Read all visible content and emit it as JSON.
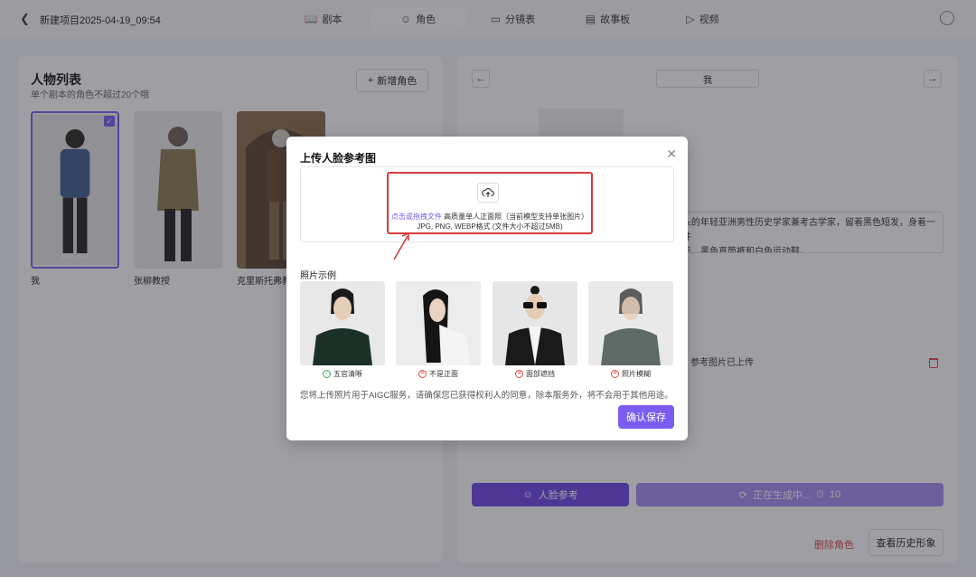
{
  "header": {
    "back_icon": "chevron-left-icon",
    "project_title": "新建项目2025-04-19_09:54",
    "tabs": [
      {
        "label": "剧本",
        "icon": "book-icon"
      },
      {
        "label": "角色",
        "icon": "smile-icon"
      },
      {
        "label": "分镜表",
        "icon": "clapper-icon"
      },
      {
        "label": "故事板",
        "icon": "film-icon"
      },
      {
        "label": "视频",
        "icon": "video-icon"
      }
    ],
    "active_tab": "角色",
    "user_icon": "user-icon"
  },
  "left_panel": {
    "title": "人物列表",
    "subtitle": "单个剧本的角色不超过20个哦",
    "add_button": "新增角色",
    "characters": [
      {
        "name": "我",
        "selected": true
      },
      {
        "name": "张柳教授",
        "selected": false
      },
      {
        "name": "克里斯托弗教",
        "selected": false
      }
    ]
  },
  "right_panel": {
    "character_name": "我",
    "description": "头的年轻亚洲男性历史学家兼考古学家，留着黑色短发，身着一件\n衫、黑色直筒裤和白色运动鞋。",
    "uploaded_text": "参考图片已上传",
    "face_ref_button": "人脸参考",
    "generating_button": "正在生成中...",
    "generating_count": "10",
    "delete_role": "删除角色",
    "history_button": "查看历史形象"
  },
  "modal": {
    "title": "上传人脸参考图",
    "upload_link": "点击或拖拽文件",
    "upload_hint": "高质量单人正面照（当前模型支持单张图片）",
    "upload_formats": "JPG, PNG, WEBP格式 (文件大小不超过5MB)",
    "sample_label": "照片示例",
    "samples": [
      {
        "caption": "五官清晰",
        "status": "ok"
      },
      {
        "caption": "不是正面",
        "status": "bad"
      },
      {
        "caption": "面部遮挡",
        "status": "bad"
      },
      {
        "caption": "照片模糊",
        "status": "bad"
      }
    ],
    "notice": "您将上传照片用于AIGC服务，请确保您已获得权利人的同意，除本服务外，将不会用于其他用途。",
    "confirm_button": "确认保存"
  },
  "colors": {
    "accent": "#7b5cf0",
    "highlight_box": "#d63b3b",
    "danger": "#e04848"
  }
}
